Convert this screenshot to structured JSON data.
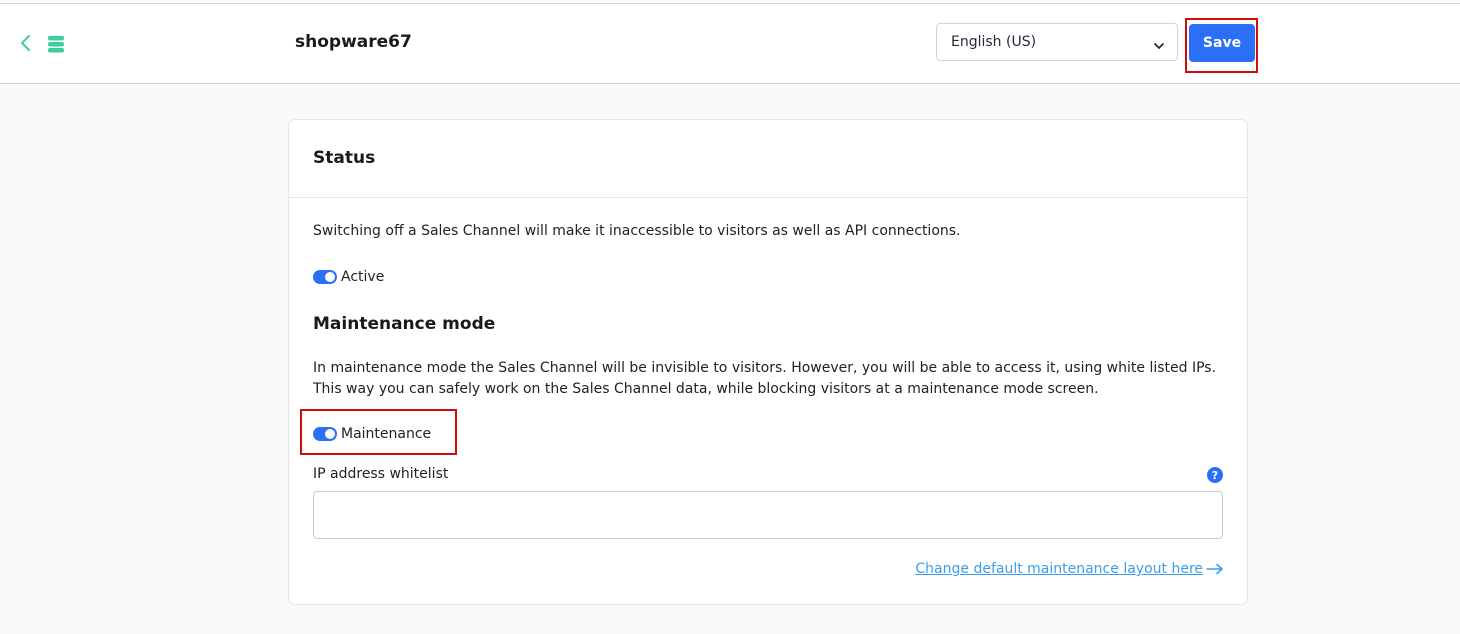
{
  "header": {
    "title": "shopware67",
    "language": {
      "selected": "English (US)"
    },
    "save_label": "Save"
  },
  "card": {
    "title": "Status",
    "description": "Switching off a Sales Channel will make it inaccessible to visitors as well as API connections.",
    "active_toggle": {
      "label": "Active",
      "checked": true
    },
    "maintenance": {
      "title": "Maintenance mode",
      "description": "In maintenance mode the Sales Channel will be invisible to visitors. However, you will be able to access it, using white listed IPs. This way you can safely work on the Sales Channel data, while blocking visitors at a maintenance mode screen.",
      "toggle": {
        "label": "Maintenance",
        "checked": true
      },
      "ip_whitelist_label": "IP address whitelist",
      "ip_whitelist_value": "",
      "help_icon_glyph": "?",
      "layout_link": "Change default maintenance layout here"
    }
  },
  "colors": {
    "accent": "#2b6ff7",
    "highlight": "#d20a0a",
    "link": "#3b9ee8",
    "sales_channel_icon": "#3ccf9b"
  },
  "icons": [
    "back-chevron-icon",
    "sales-channel-icon",
    "chevron-down-icon",
    "help-icon",
    "arrow-right-icon"
  ]
}
